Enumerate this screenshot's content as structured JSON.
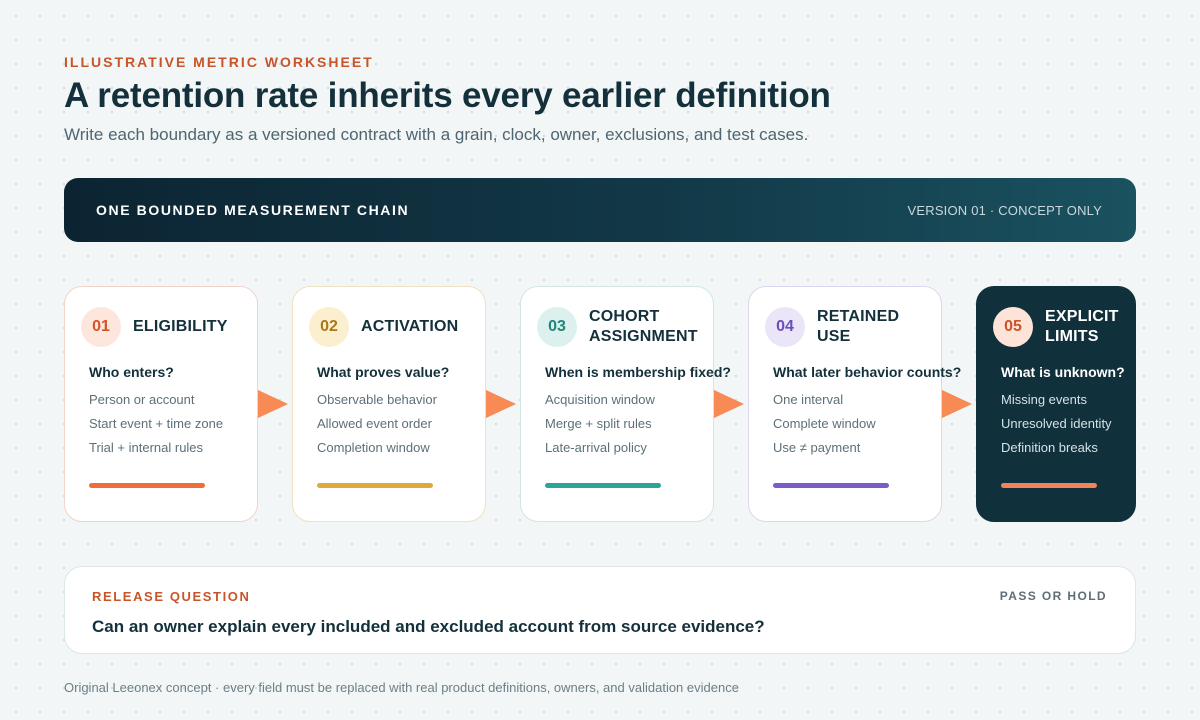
{
  "header": {
    "eyebrow": "ILLUSTRATIVE METRIC WORKSHEET",
    "title": "A retention rate inherits every earlier definition",
    "subtitle": "Write each boundary as a versioned contract with a grain, clock, owner, exclusions, and test cases."
  },
  "banner": {
    "title": "ONE BOUNDED MEASUREMENT CHAIN",
    "version": "VERSION 01 · CONCEPT ONLY"
  },
  "steps": [
    {
      "number": "01",
      "title": "ELIGIBILITY",
      "question": "Who enters?",
      "items": [
        "Person or account",
        "Start event + time zone",
        "Trial + internal rules"
      ],
      "accent": "#f26b3a",
      "badge_bg": "#fde6dc",
      "border": "#f1d4c8"
    },
    {
      "number": "02",
      "title": "ACTIVATION",
      "question": "What proves value?",
      "items": [
        "Observable behavior",
        "Allowed event order",
        "Completion window"
      ],
      "accent": "#e0a93b",
      "badge_bg": "#fcefcf",
      "border": "#efe2c2"
    },
    {
      "number": "03",
      "title": "COHORT ASSIGNMENT",
      "question": "When is membership fixed?",
      "items": [
        "Acquisition window",
        "Merge + split rules",
        "Late-arrival policy"
      ],
      "accent": "#2aa597",
      "badge_bg": "#dcf1ee",
      "border": "#cfe6e3"
    },
    {
      "number": "04",
      "title": "RETAINED USE",
      "question": "What later behavior counts?",
      "items": [
        "One interval",
        "Complete window",
        "Use ≠ payment"
      ],
      "accent": "#7a5dc7",
      "badge_bg": "#ebe5f8",
      "border": "#ddd6f0"
    },
    {
      "number": "05",
      "title": "EXPLICIT LIMITS",
      "question": "What is unknown?",
      "items": [
        "Missing events",
        "Unresolved identity",
        "Definition breaks"
      ],
      "accent": "#f2835a",
      "badge_bg": "#fde3d8",
      "border": "#10303c"
    }
  ],
  "release": {
    "label": "RELEASE QUESTION",
    "tag": "PASS OR HOLD",
    "question": "Can an owner explain every included and excluded account from source evidence?"
  },
  "footer": "Original Leeonex concept · every field must be replaced with real product definitions, owners, and validation evidence",
  "colors": {
    "arrow": "#f78a55",
    "eyebrow": "#c8552a",
    "navy": "#13303b"
  }
}
